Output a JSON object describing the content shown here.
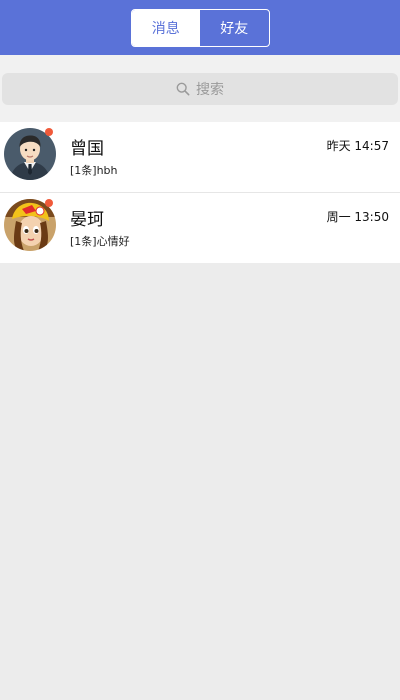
{
  "header": {
    "tabs": [
      {
        "label": "消息",
        "active": true
      },
      {
        "label": "好友",
        "active": false
      }
    ],
    "bg_color": "#5a72d8"
  },
  "search": {
    "placeholder": "搜索",
    "icon": "search-icon"
  },
  "conversations": [
    {
      "name": "曾国",
      "preview": "[1条]hbh",
      "time": "昨天 14:57",
      "avatar": "avatar-man-suit",
      "unread_dot": true
    },
    {
      "name": "晏珂",
      "preview": "[1条]心情好",
      "time": "周一 13:50",
      "avatar": "avatar-game-character",
      "unread_dot": true
    }
  ],
  "colors": {
    "accent": "#5a72d8",
    "badge": "#f05a3a",
    "background": "#ececec"
  }
}
